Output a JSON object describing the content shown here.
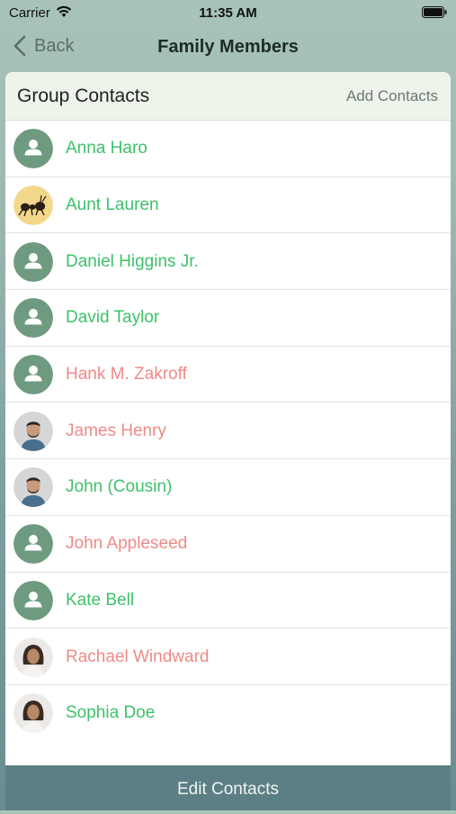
{
  "status": {
    "carrier": "Carrier",
    "time": "11:35 AM"
  },
  "nav": {
    "back_label": "Back",
    "title": "Family Members"
  },
  "header": {
    "title": "Group Contacts",
    "add_label": "Add Contacts"
  },
  "contacts": [
    {
      "name": "Anna Haro",
      "color": "#3ec16a",
      "avatar": "default-person-icon"
    },
    {
      "name": "Aunt Lauren",
      "color": "#3ec16a",
      "avatar": "ant-photo"
    },
    {
      "name": "Daniel Higgins Jr.",
      "color": "#3ec16a",
      "avatar": "default-person-icon"
    },
    {
      "name": "David Taylor",
      "color": "#3ec16a",
      "avatar": "default-person-icon"
    },
    {
      "name": "Hank M. Zakroff",
      "color": "#ef8a88",
      "avatar": "default-person-icon"
    },
    {
      "name": "James Henry",
      "color": "#ef8a88",
      "avatar": "man-photo"
    },
    {
      "name": "John (Cousin)",
      "color": "#3ec16a",
      "avatar": "man-photo"
    },
    {
      "name": "John Appleseed",
      "color": "#ef8a88",
      "avatar": "default-person-icon"
    },
    {
      "name": "Kate Bell",
      "color": "#3ec16a",
      "avatar": "default-person-icon"
    },
    {
      "name": "Rachael Windward",
      "color": "#ef8a88",
      "avatar": "woman-photo"
    },
    {
      "name": "Sophia Doe",
      "color": "#3ec16a",
      "avatar": "woman-photo"
    }
  ],
  "footer": {
    "edit_label": "Edit Contacts"
  },
  "colors": {
    "green_name": "#3ec16a",
    "red_name": "#ef8a88",
    "default_avatar": "#6e9a80",
    "footer_bg": "#5b7f84"
  }
}
